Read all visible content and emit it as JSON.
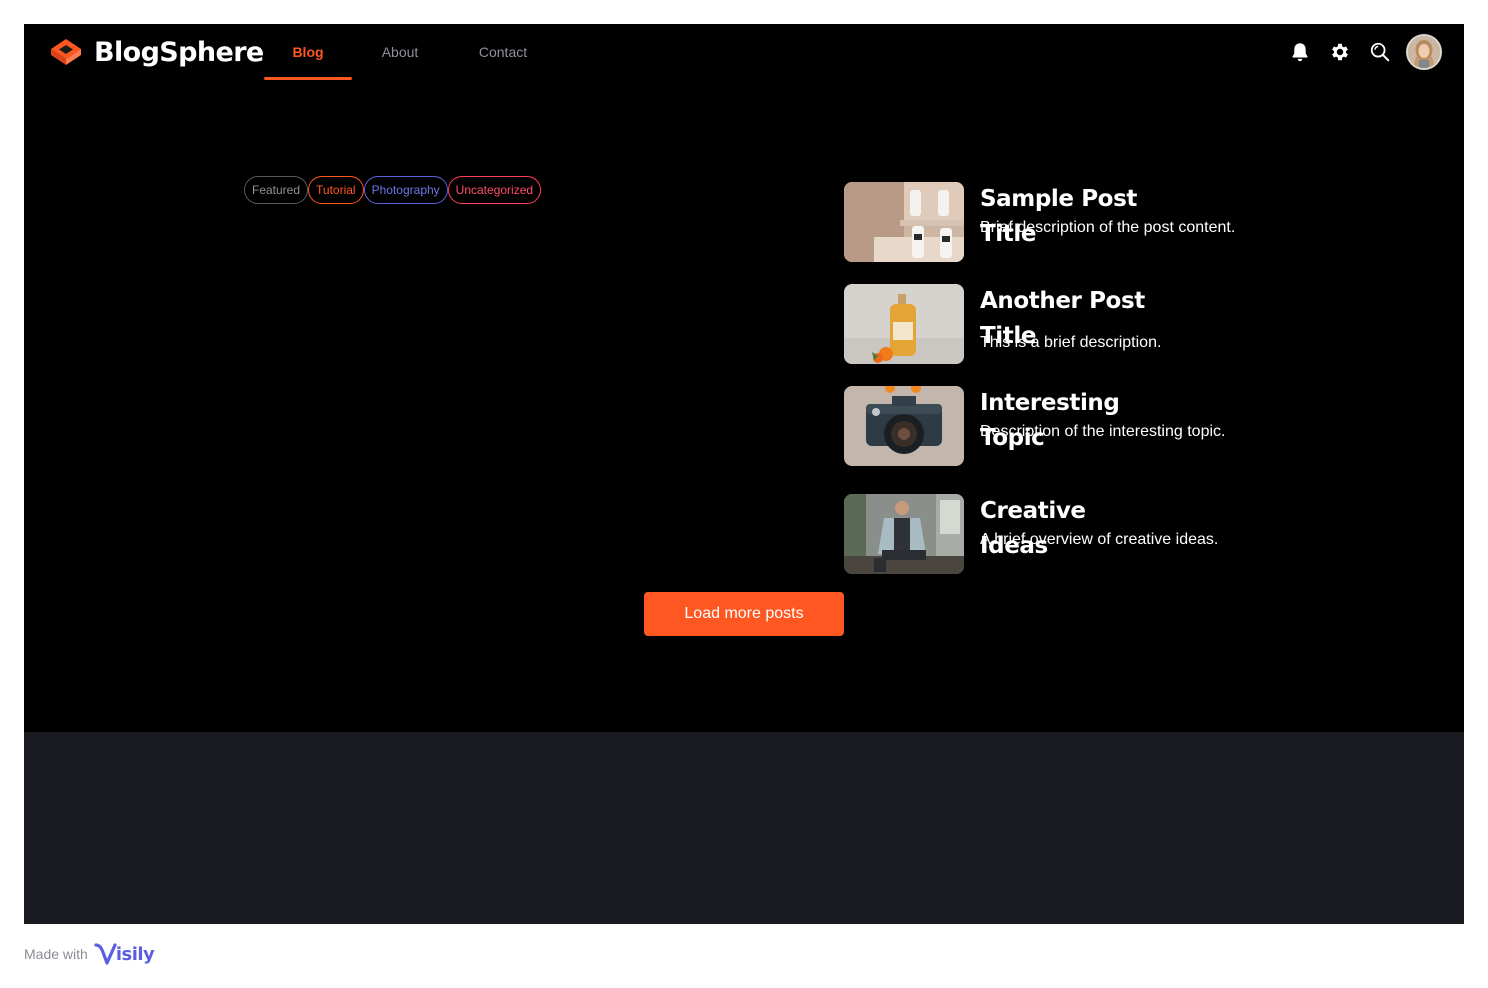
{
  "app": {
    "name": "BlogSphere"
  },
  "nav": {
    "items": [
      {
        "label": "Blog",
        "active": true
      },
      {
        "label": "About",
        "active": false
      },
      {
        "label": "Contact",
        "active": false
      }
    ]
  },
  "header_actions": {
    "icons": [
      "bell-icon",
      "gear-icon",
      "search-icon"
    ]
  },
  "categories": [
    "Featured",
    "Tutorial",
    "Photography",
    "Uncategorized"
  ],
  "posts": [
    {
      "title": "Sample Post Title",
      "description": "Brief description of the post content.",
      "thumbnail": "milk-bottles-photo"
    },
    {
      "title": "Another Post Title",
      "description": "This is a brief description.",
      "thumbnail": "bottle-orange-photo"
    },
    {
      "title": "Interesting Topic",
      "description": "Description of the interesting topic.",
      "thumbnail": "camera-photo"
    },
    {
      "title": "Creative Ideas",
      "description": "A brief overview of creative ideas.",
      "thumbnail": "man-seated-photo"
    }
  ],
  "load_more": {
    "label": "Load more posts"
  },
  "made_with": {
    "text": "Made with",
    "brand": "Visily"
  },
  "colors": {
    "accent": "#ff5722",
    "background": "#000000",
    "footer": "#181a1f",
    "chip_photography": "#5a62d8",
    "chip_uncategorized": "#ff3e5a"
  }
}
